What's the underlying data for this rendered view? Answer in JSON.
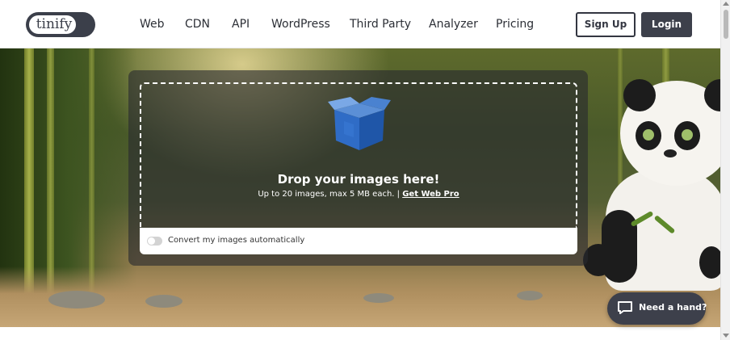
{
  "header": {
    "logo_text": "tinify",
    "nav": [
      {
        "label": "Web"
      },
      {
        "label": "CDN"
      },
      {
        "label": "API"
      },
      {
        "label": "WordPress"
      },
      {
        "label": "Third Party"
      },
      {
        "label": "Analyzer"
      },
      {
        "label": "Pricing"
      }
    ],
    "signup_label": "Sign Up",
    "login_label": "Login"
  },
  "upload": {
    "icon": "box-icon",
    "title": "Drop your images here!",
    "subtitle": "Up to 20 images, max 5 MB each. |",
    "web_pro_link": "Get Web Pro",
    "convert_label": "Convert my images automatically",
    "convert_enabled": false
  },
  "chat": {
    "icon": "chat-bubble-icon",
    "label": "Need a hand?"
  },
  "colors": {
    "primary_dark": "#3d404b",
    "white": "#ffffff"
  }
}
